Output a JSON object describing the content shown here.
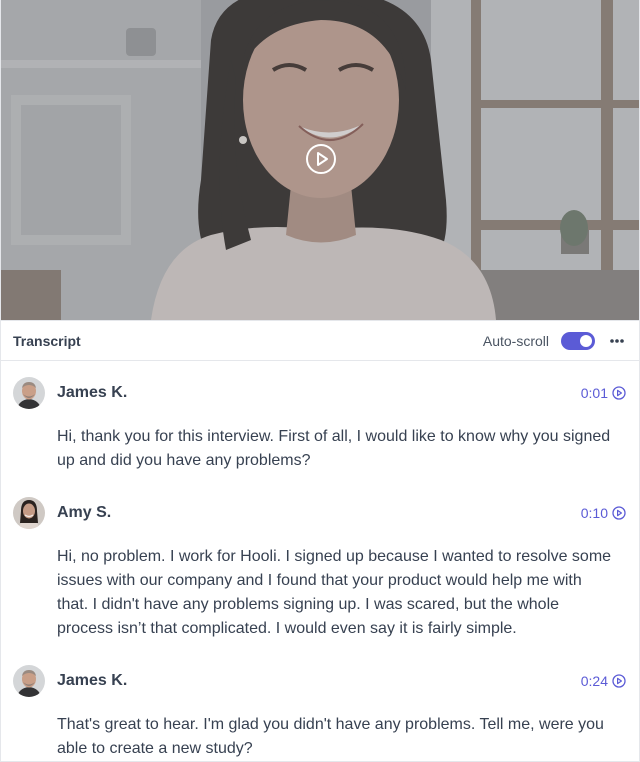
{
  "video": {
    "play_icon": "play-circle-icon"
  },
  "transcript": {
    "title": "Transcript",
    "autoscroll_label": "Auto-scroll",
    "autoscroll_on": true,
    "more_icon": "more-horizontal-icon",
    "accent_color": "#5b5bd6"
  },
  "entries": [
    {
      "speaker": "James K.",
      "time": "0:01",
      "text": "Hi, thank you for this interview. First of all, I would like to know why you signed up and did you have any problems?"
    },
    {
      "speaker": "Amy S.",
      "time": "0:10",
      "text": "Hi, no problem. I work for Hooli. I signed up because I wanted to resolve some issues with our company and I found that your product would help me with that. I didn't have any problems signing up. I was scared, but the whole process isn’t that complicated. I would even say it is fairly simple."
    },
    {
      "speaker": "James K.",
      "time": "0:24",
      "text": "That's great to hear. I'm glad you didn't have any problems. Tell me, were you able to create a new study?"
    }
  ]
}
